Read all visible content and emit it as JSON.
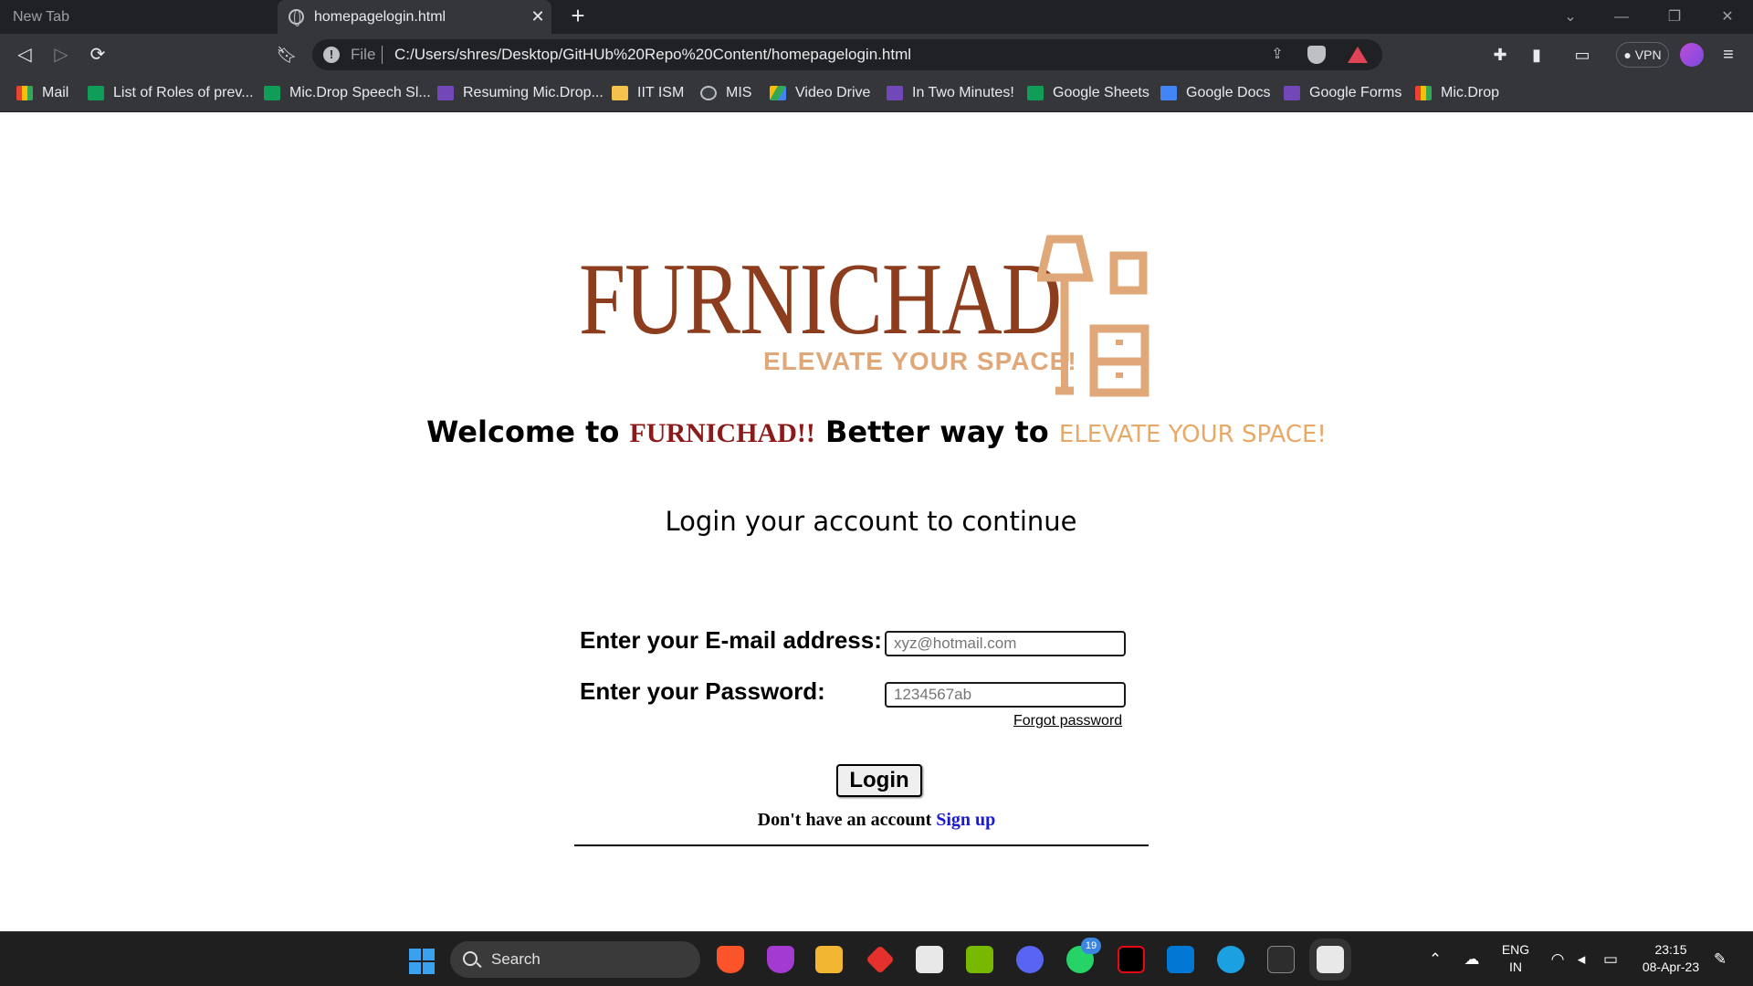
{
  "browser": {
    "tabs": [
      {
        "label": "New Tab",
        "active": false
      },
      {
        "label": "homepagelogin.html",
        "active": true
      }
    ],
    "address": {
      "scheme": "File",
      "url": "C:/Users/shres/Desktop/GitHUb%20Repo%20Content/homepagelogin.html"
    },
    "vpn_label": "VPN",
    "bookmarks": [
      {
        "label": "Mail",
        "icon": "gmail-icon"
      },
      {
        "label": "List of Roles of prev...",
        "icon": "sheets-icon"
      },
      {
        "label": "Mic.Drop Speech Sl...",
        "icon": "sheets-icon"
      },
      {
        "label": "Resuming Mic.Drop...",
        "icon": "forms-icon"
      },
      {
        "label": "IIT ISM",
        "icon": "folder-icon"
      },
      {
        "label": "MIS",
        "icon": "globe-icon"
      },
      {
        "label": "Video Drive",
        "icon": "drive-icon"
      },
      {
        "label": "In Two Minutes!",
        "icon": "forms-icon"
      },
      {
        "label": "Google Sheets",
        "icon": "sheets-icon"
      },
      {
        "label": "Google Docs",
        "icon": "docs-icon"
      },
      {
        "label": "Google Forms",
        "icon": "forms-icon"
      },
      {
        "label": "Mic.Drop",
        "icon": "gmail-icon"
      }
    ]
  },
  "page": {
    "logo": {
      "name": "FURNICHAD",
      "tagline": "ELEVATE YOUR SPACE!"
    },
    "welcome": {
      "prefix": "Welcome to ",
      "brand": "FURNICHAD!!",
      "middle": " Better way to ",
      "tagline": "ELEVATE YOUR SPACE!"
    },
    "login_heading": "Login your account to continue",
    "form": {
      "email_label": "Enter your E-mail address:",
      "email_placeholder": "xyz@hotmail.com",
      "password_label": "Enter your Password:",
      "password_placeholder": "1234567ab",
      "forgot_link": "Forgot password",
      "login_button": "Login",
      "signup_prompt": "Don't have an account ",
      "signup_link": "Sign up"
    },
    "colors": {
      "brand_brown": "#8b3d1e",
      "brand_tan": "#e0a878",
      "link_blue": "#1a1ad0"
    }
  },
  "taskbar": {
    "search_label": "Search",
    "whatsapp_badge": "19",
    "language": "ENG",
    "region": "IN",
    "time": "23:15",
    "date": "08-Apr-23"
  }
}
